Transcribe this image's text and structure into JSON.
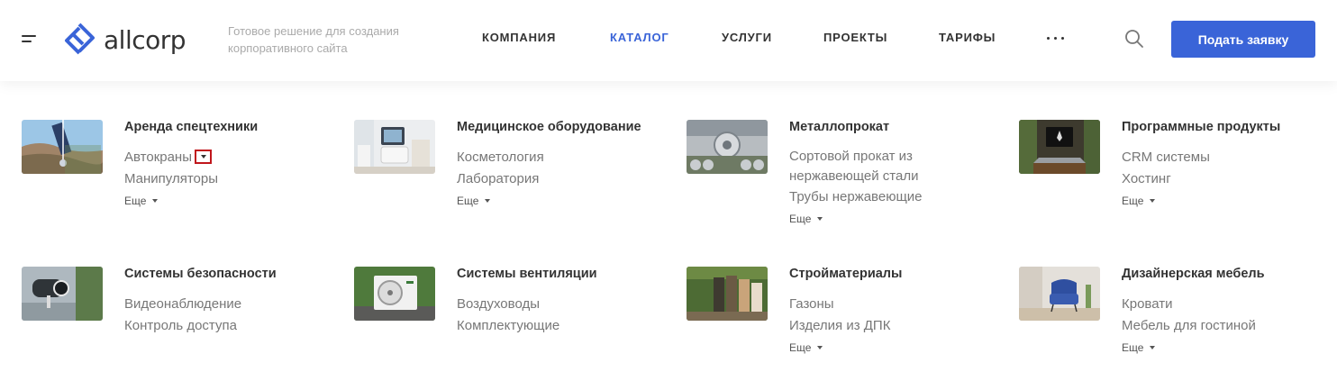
{
  "header": {
    "logo_text": "allcorp",
    "tagline": "Готовое решение для создания корпоративного сайта",
    "nav": [
      {
        "label": "Компания",
        "active": false
      },
      {
        "label": "Каталог",
        "active": true
      },
      {
        "label": "Услуги",
        "active": false
      },
      {
        "label": "Проекты",
        "active": false
      },
      {
        "label": "Тарифы",
        "active": false
      }
    ],
    "cta_label": "Подать заявку",
    "accent_color": "#3a64d8"
  },
  "catalog": {
    "more_label": "Еще",
    "categories": [
      {
        "title": "Аренда спецтехники",
        "links": [
          "Автокраны",
          "Манипуляторы"
        ],
        "image": "crane-photo"
      },
      {
        "title": "Медицинское оборудование",
        "links": [
          "Косметология",
          "Лаборатория"
        ],
        "image": "medical-equipment-photo"
      },
      {
        "title": "Металлопрокат",
        "links": [
          "Сортовой прокат из нержавеющей стали",
          "Трубы нержавеющие"
        ],
        "image": "metal-pipes-photo"
      },
      {
        "title": "Программные продукты",
        "links": [
          "CRM системы",
          "Хостинг"
        ],
        "image": "laptop-photo"
      },
      {
        "title": "Системы безопасности",
        "links": [
          "Видеонаблюдение",
          "Контроль доступа"
        ],
        "image": "security-camera-photo"
      },
      {
        "title": "Системы вентиляции",
        "links": [
          "Воздуховоды",
          "Комплектующие"
        ],
        "image": "air-conditioner-photo"
      },
      {
        "title": "Стройматериалы",
        "links": [
          "Газоны",
          "Изделия из ДПК"
        ],
        "image": "building-materials-photo"
      },
      {
        "title": "Дизайнерская мебель",
        "links": [
          "Кровати",
          "Мебель для гостиной"
        ],
        "image": "armchair-photo"
      }
    ]
  }
}
